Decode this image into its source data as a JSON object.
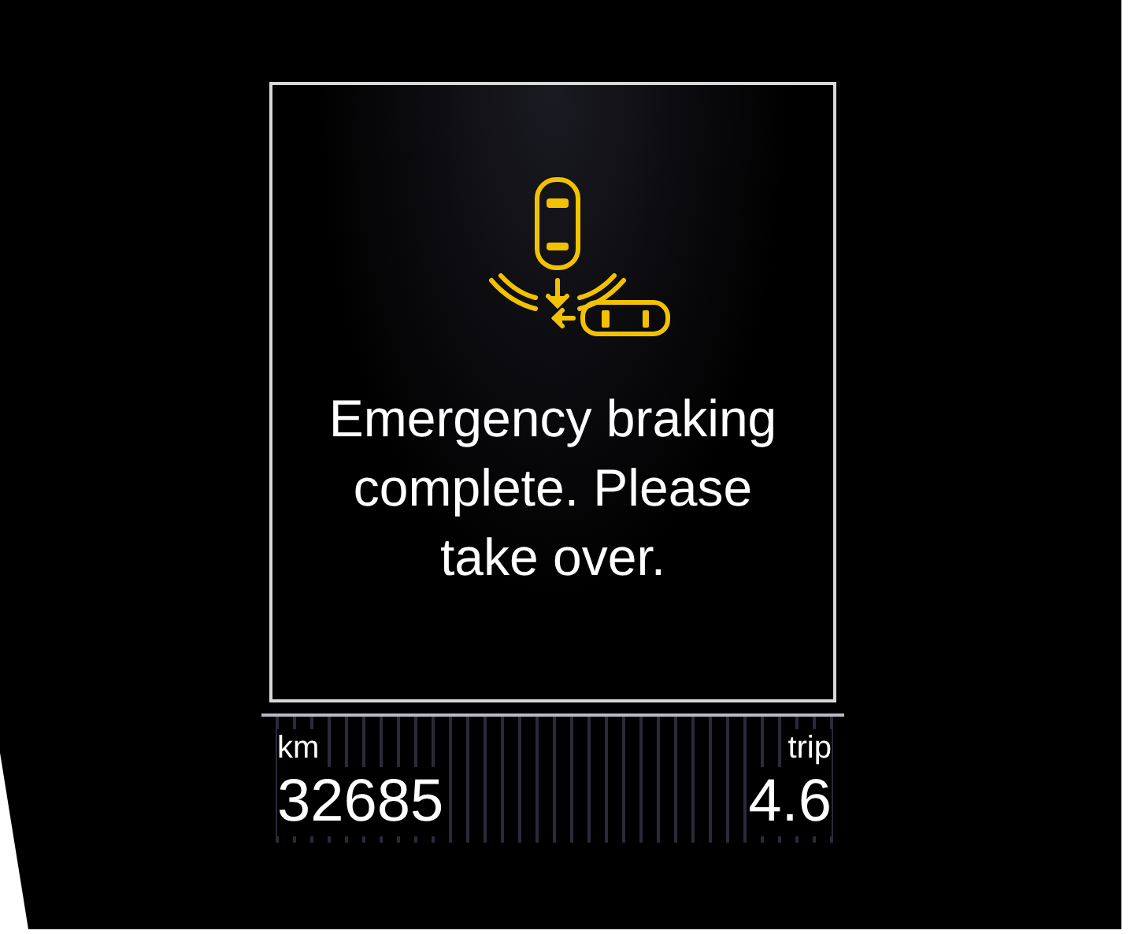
{
  "message": {
    "text": "Emergency braking complete. Please take over."
  },
  "odometer": {
    "label": "km",
    "value": "32685"
  },
  "trip": {
    "label": "trip",
    "value": "4.6"
  }
}
